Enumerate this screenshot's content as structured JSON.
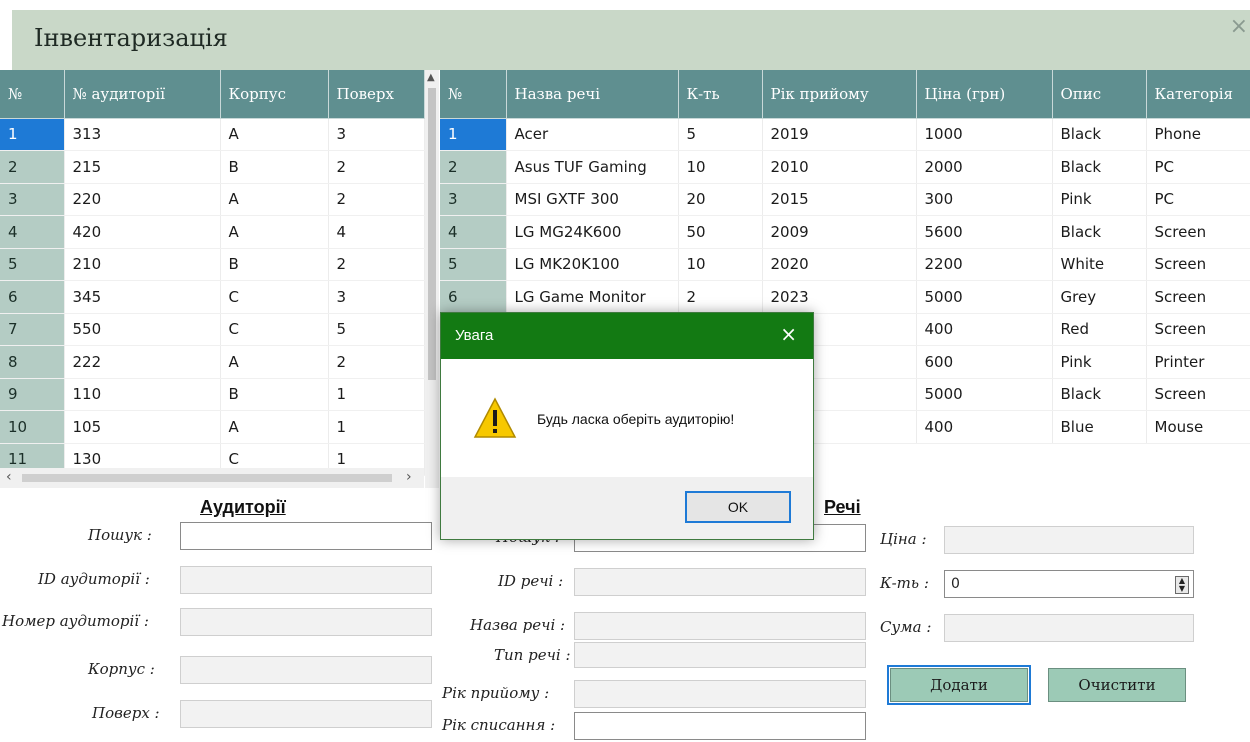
{
  "window": {
    "title": "Інвентаризація",
    "close_glyph": "×"
  },
  "rooms_table": {
    "headers": [
      "№",
      "№ аудиторії",
      "Корпус",
      "Поверх"
    ],
    "rows": [
      [
        "1",
        "313",
        "A",
        "3"
      ],
      [
        "2",
        "215",
        "B",
        "2"
      ],
      [
        "3",
        "220",
        "A",
        "2"
      ],
      [
        "4",
        "420",
        "A",
        "4"
      ],
      [
        "5",
        "210",
        "B",
        "2"
      ],
      [
        "6",
        "345",
        "C",
        "3"
      ],
      [
        "7",
        "550",
        "C",
        "5"
      ],
      [
        "8",
        "222",
        "A",
        "2"
      ],
      [
        "9",
        "110",
        "B",
        "1"
      ],
      [
        "10",
        "105",
        "A",
        "1"
      ],
      [
        "11",
        "130",
        "C",
        "1"
      ]
    ]
  },
  "items_table": {
    "headers": [
      "№",
      "Назва речі",
      "К-ть",
      "Рік прийому",
      "Ціна (грн)",
      "Опис",
      "Категорія"
    ],
    "rows": [
      [
        "1",
        "Acer",
        "5",
        "2019",
        "1000",
        "Black",
        "Phone"
      ],
      [
        "2",
        "Asus TUF Gaming",
        "10",
        "2010",
        "2000",
        "Black",
        "PC"
      ],
      [
        "3",
        "MSI GXTF 300",
        "20",
        "2015",
        "300",
        "Pink",
        "PC"
      ],
      [
        "4",
        "LG MG24K600",
        "50",
        "2009",
        "5600",
        "Black",
        "Screen"
      ],
      [
        "5",
        "LG MK20K100",
        "10",
        "2020",
        "2200",
        "White",
        "Screen"
      ],
      [
        "6",
        "LG Game Monitor",
        "2",
        "2023",
        "5000",
        "Grey",
        "Screen"
      ],
      [
        "",
        "",
        "",
        "",
        "400",
        "Red",
        "Screen"
      ],
      [
        "",
        "",
        "",
        "",
        "600",
        "Pink",
        "Printer"
      ],
      [
        "",
        "",
        "",
        "",
        "5000",
        "Black",
        "Screen"
      ],
      [
        "",
        "",
        "",
        "",
        "400",
        "Blue",
        "Mouse"
      ]
    ]
  },
  "rooms_form": {
    "title": "Аудиторії",
    "search_label": "Пошук :",
    "id_label": "ID аудиторії :",
    "number_label": "Номер аудиторії :",
    "building_label": "Корпус :",
    "floor_label": "Поверх :"
  },
  "items_form": {
    "title": "Речі",
    "search_label": "Пошук :",
    "id_label": "ID речі :",
    "name_label": "Назва речі :",
    "type_label": "Тип речі :",
    "accept_year_label": "Рік прийому :",
    "writeoff_year_label": "Рік списання :",
    "price_label": "Ціна :",
    "qty_label": "К-ть :",
    "qty_value": "0",
    "sum_label": "Сума :"
  },
  "buttons": {
    "add": "Додати",
    "clear": "Очистити"
  },
  "dialog": {
    "title": "Увага",
    "message": "Будь ласка оберіть аудиторію!",
    "ok": "OK",
    "icon": "warning-icon"
  },
  "colors": {
    "header": "#5f8f90",
    "title_bar": "#c9d8c8",
    "dialog_header": "#137a13",
    "selection": "#1e7ad6",
    "button": "#9ccab6"
  }
}
